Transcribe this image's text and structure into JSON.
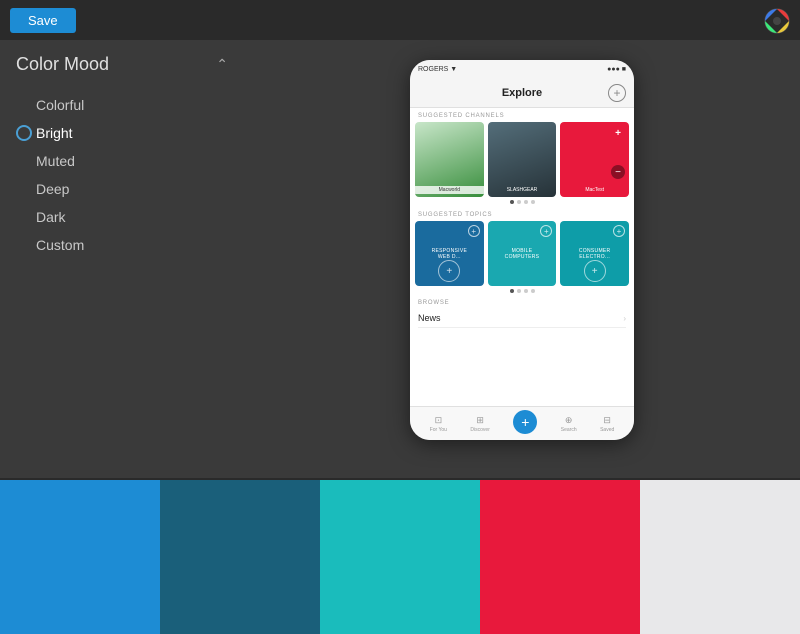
{
  "topbar": {
    "save_label": "Save"
  },
  "panel": {
    "title": "Color Mood",
    "collapse_icon": "⌃",
    "items": [
      {
        "id": "colorful",
        "label": "Colorful",
        "selected": false
      },
      {
        "id": "bright",
        "label": "Bright",
        "selected": true
      },
      {
        "id": "muted",
        "label": "Muted",
        "selected": false
      },
      {
        "id": "deep",
        "label": "Deep",
        "selected": false
      },
      {
        "id": "dark",
        "label": "Dark",
        "selected": false
      },
      {
        "id": "custom",
        "label": "Custom",
        "selected": false
      }
    ]
  },
  "phone": {
    "status": {
      "carrier": "ROGERS ▼",
      "time": "●●●",
      "battery": "■"
    },
    "nav_title": "Explore",
    "sections": {
      "suggested_channels": "SUGGESTED CHANNELS",
      "channels": [
        {
          "label": "Macworld",
          "type": "green"
        },
        {
          "label": "SLASHGEAR",
          "type": "dark"
        },
        {
          "label": "MacTest",
          "type": "red"
        }
      ],
      "suggested_topics": "SUGGESTED TOPICS",
      "topics": [
        {
          "label": "RESPONSIVE WEB D...",
          "color": "blue"
        },
        {
          "label": "MOBILE COMPUTERS",
          "color": "teal"
        },
        {
          "label": "CONSUMER ELECTRONICS",
          "color": "teal2"
        }
      ],
      "browse": "BROWSE",
      "browse_items": [
        {
          "label": "News"
        }
      ]
    },
    "tabbar": {
      "tabs": [
        {
          "label": "For You",
          "icon": "⊡",
          "active": false
        },
        {
          "label": "Discover",
          "icon": "⊞",
          "active": false
        },
        {
          "label": "",
          "icon": "+",
          "active": true,
          "center": true
        },
        {
          "label": "Search",
          "icon": "⊕",
          "active": false
        },
        {
          "label": "Saved",
          "icon": "⊟",
          "active": false
        }
      ]
    }
  },
  "palette": {
    "swatches": [
      {
        "color": "#1d8cd4",
        "label": "blue"
      },
      {
        "color": "#1a5f7a",
        "label": "dark-blue"
      },
      {
        "color": "#1abcbc",
        "label": "teal"
      },
      {
        "color": "#e8193c",
        "label": "red"
      },
      {
        "color": "#e8e8ea",
        "label": "light-gray"
      }
    ]
  }
}
